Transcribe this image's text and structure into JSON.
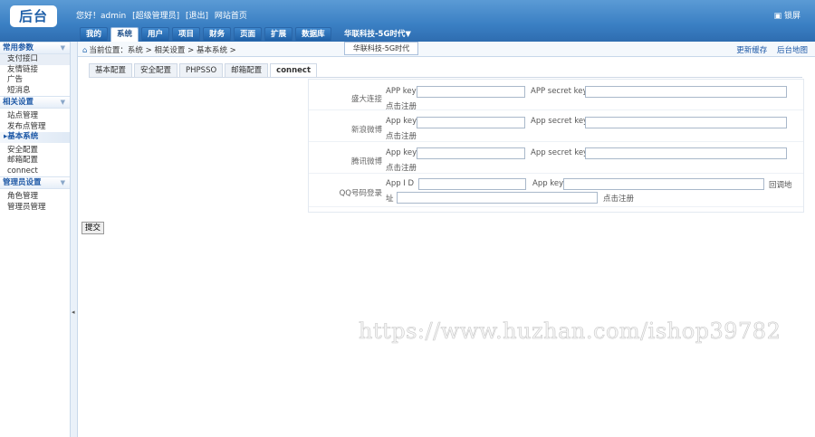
{
  "header": {
    "logo": "后台",
    "welcome": "您好！admin",
    "role": "[超级管理员]",
    "logout": "[退出]",
    "site_home": "网站首页",
    "lock": "锁屏",
    "site_selector": "华联科技-5G时代"
  },
  "nav": [
    "我的",
    "系统",
    "用户",
    "项目",
    "财务",
    "页面",
    "扩展",
    "数据库"
  ],
  "sidebar": {
    "groups": [
      {
        "title": "常用参数",
        "items": [
          "支付接口",
          "友情链接",
          "广告",
          "短消息"
        ]
      },
      {
        "title": "相关设置",
        "items": [
          "站点管理",
          "发布点管理",
          "基本系统",
          "安全配置",
          "邮箱配置",
          "connect"
        ]
      },
      {
        "title": "管理员设置",
        "items": [
          "角色管理",
          "管理员管理"
        ]
      }
    ],
    "current_item": "基本系统"
  },
  "breadcrumb": "当前位置：系统 > 相关设置 > 基本系统 >",
  "site_popup": "华联科技-5G时代",
  "toplinks": {
    "cache": "更新缓存",
    "map": "后台地图"
  },
  "subtabs": [
    "基本配置",
    "安全配置",
    "PHPSSO",
    "邮箱配置",
    "connect"
  ],
  "form": {
    "sina": {
      "label": "盛大连接",
      "key_label": "APP key",
      "secret_label": "APP secret key",
      "register": "点击注册"
    },
    "weibo": {
      "label": "新浪微博",
      "key_label": "App key",
      "secret_label": "App secret key",
      "register": "点击注册"
    },
    "tencent": {
      "label": "腾讯微博",
      "key_label": "App key",
      "secret_label": "App secret key",
      "register": "点击注册"
    },
    "qq": {
      "label": "QQ号码登录",
      "id_label": "App I D",
      "key_label": "App key",
      "callback_label_a": "回调地",
      "callback_label_b": "址",
      "register": "点击注册"
    }
  },
  "submit": "提交",
  "watermark": "https://www.huzhan.com/ishop39782"
}
